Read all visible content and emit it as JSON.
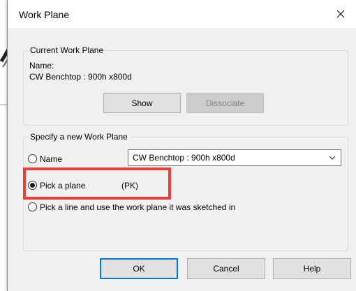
{
  "window": {
    "title": "Work Plane"
  },
  "current_work_plane": {
    "legend": "Current Work Plane",
    "name_label": "Name:",
    "name_value": "CW Benchtop : 900h x800d",
    "show_label": "Show",
    "dissociate_label": "Dissociate"
  },
  "new_work_plane": {
    "legend": "Specify a new Work Plane",
    "options": [
      {
        "label": "Name",
        "checked": false
      },
      {
        "label": "Pick a plane",
        "checked": true,
        "shortcut": "(PK)"
      },
      {
        "label": "Pick a line and use the work plane it was sketched in",
        "checked": false
      }
    ],
    "name_select_value": "CW Benchtop : 900h x800d"
  },
  "footer": {
    "ok_label": "OK",
    "cancel_label": "Cancel",
    "help_label": "Help"
  },
  "colors": {
    "highlight": "#e8403a",
    "default_button_border": "#0078d7"
  },
  "icons": {
    "close": "close-icon",
    "dropdown": "chevron-down-icon"
  }
}
